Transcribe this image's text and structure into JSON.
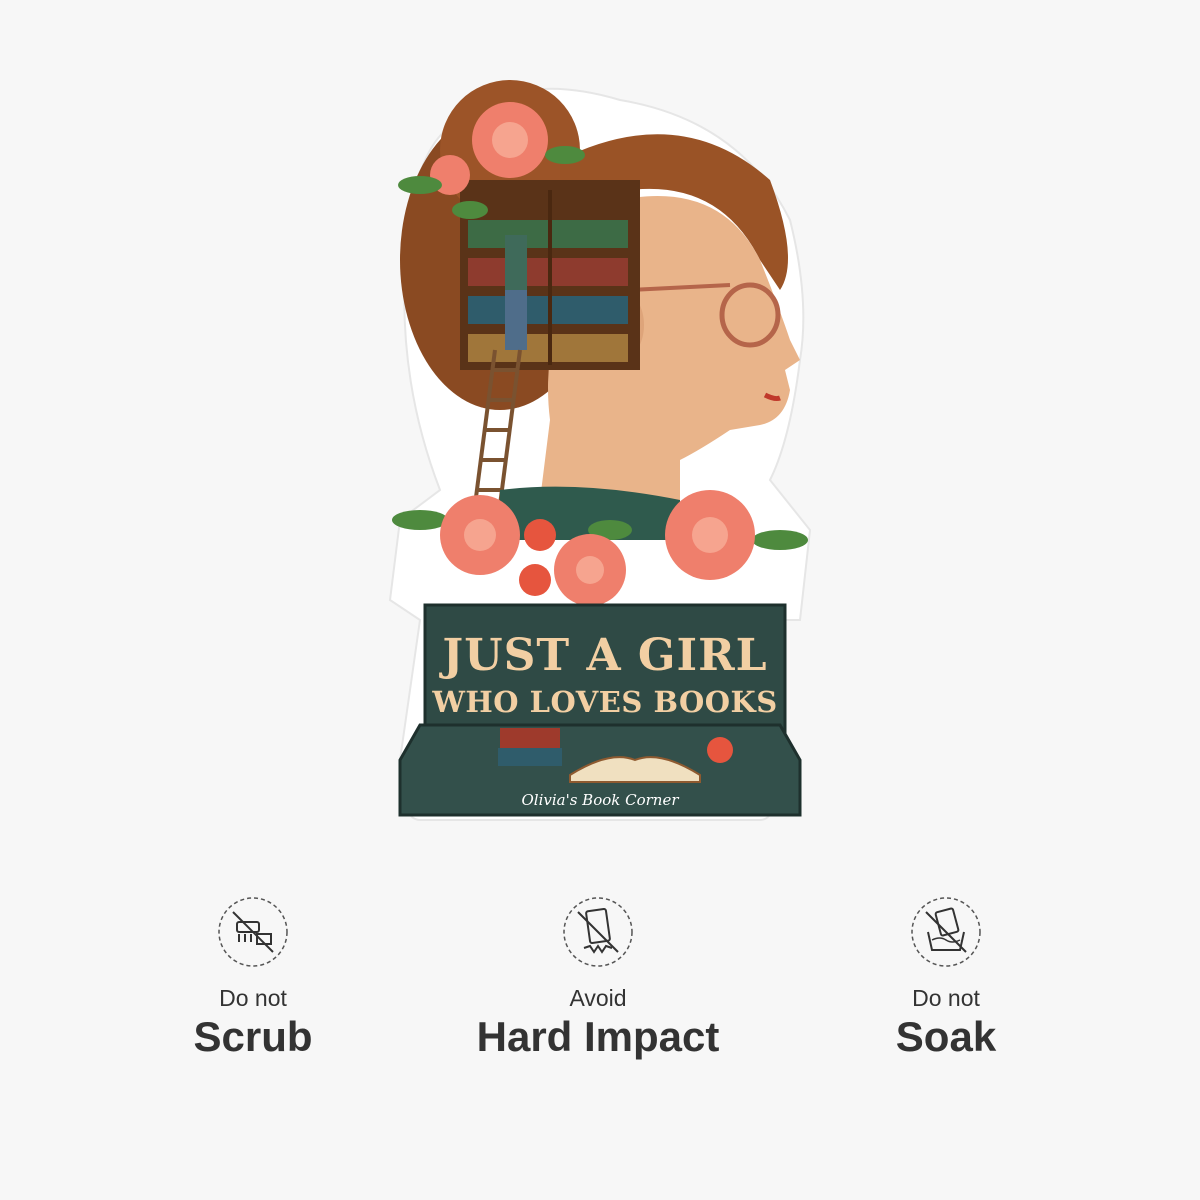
{
  "product": {
    "title_line1": "JUST A GIRL",
    "title_line2": "WHO LOVES BOOKS",
    "signature": "Olivia's Book Corner",
    "colors": {
      "hair": "#8a4a22",
      "skin": "#e9b48a",
      "flower": "#ef7f6c",
      "leaf": "#4e8a3e",
      "plaque": "#2f4a45",
      "lettering": "#f2cfa3"
    }
  },
  "care": [
    {
      "pre": "Do not",
      "main": "Scrub",
      "icon": "no-scrub-icon"
    },
    {
      "pre": "Avoid",
      "main": "Hard Impact",
      "icon": "no-impact-icon"
    },
    {
      "pre": "Do not",
      "main": "Soak",
      "icon": "no-soak-icon"
    }
  ]
}
